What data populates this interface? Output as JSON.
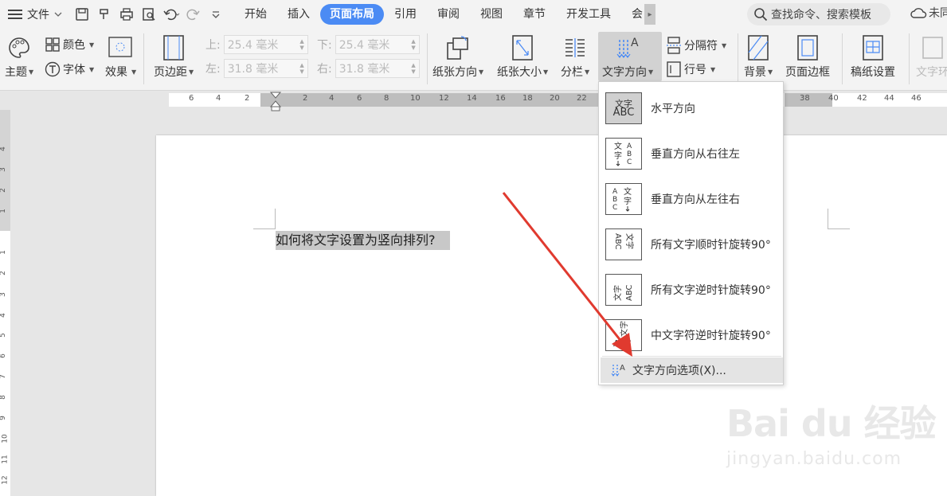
{
  "menubar": {
    "file_label": "文件",
    "tabs": [
      {
        "label": "开始"
      },
      {
        "label": "插入"
      },
      {
        "label": "页面布局"
      },
      {
        "label": "引用"
      },
      {
        "label": "审阅"
      },
      {
        "label": "视图"
      },
      {
        "label": "章节"
      },
      {
        "label": "开发工具"
      },
      {
        "label": "会"
      }
    ],
    "search_placeholder": "查找命令、搜索模板",
    "cloud_label": "未同"
  },
  "ribbon": {
    "theme": "主题",
    "color": "颜色",
    "font": "字体",
    "effect": "效果",
    "margins": "页边距",
    "top_label": "上:",
    "top_value": "25.4 毫米",
    "bottom_label": "下:",
    "bottom_value": "25.4 毫米",
    "left_label": "左:",
    "left_value": "31.8 毫米",
    "right_label": "右:",
    "right_value": "31.8 毫米",
    "orientation": "纸张方向",
    "size": "纸张大小",
    "columns": "分栏",
    "text_direction": "文字方向",
    "breaks": "分隔符",
    "line_numbers": "行号",
    "background": "背景",
    "page_border": "页面边框",
    "paper_setup": "稿纸设置",
    "text_wrap": "文字环"
  },
  "ruler": {
    "h_ticks": [
      "6",
      "4",
      "2",
      "2",
      "4",
      "6",
      "8",
      "10",
      "12",
      "14",
      "16",
      "18",
      "20",
      "22",
      "24",
      "26",
      "28",
      "38",
      "40",
      "42",
      "44",
      "46"
    ],
    "v_ticks": [
      "4",
      "3",
      "2",
      "1",
      "1",
      "2",
      "3",
      "4",
      "5",
      "6",
      "7",
      "8",
      "9",
      "10",
      "11",
      "12"
    ]
  },
  "document": {
    "text": "如何将文字设置为竖向排列?"
  },
  "dropdown": {
    "items": [
      {
        "label": "水平方向",
        "icon_top": "文字",
        "icon_bottom": "ABC"
      },
      {
        "label": "垂直方向从右往左",
        "icon_top": "文字",
        "icon_bottom": "ABC"
      },
      {
        "label": "垂直方向从左往右",
        "icon_top": "文字",
        "icon_bottom": "ABC"
      },
      {
        "label": "所有文字顺时针旋转90°",
        "icon_top": "文字",
        "icon_bottom": "ABC"
      },
      {
        "label": "所有文字逆时针旋转90°",
        "icon_top": "文字",
        "icon_bottom": "ABC"
      },
      {
        "label": "中文字符逆时针旋转90°",
        "icon_top": "文字",
        "icon_bottom": "ABC"
      }
    ],
    "options_label": "文字方向选项(X)..."
  },
  "watermark": {
    "brand": "Bai du 经验",
    "url": "jingyan.baidu.com"
  },
  "colors": {
    "accent": "#4b8bf4",
    "arrow": "#e03a2f"
  }
}
